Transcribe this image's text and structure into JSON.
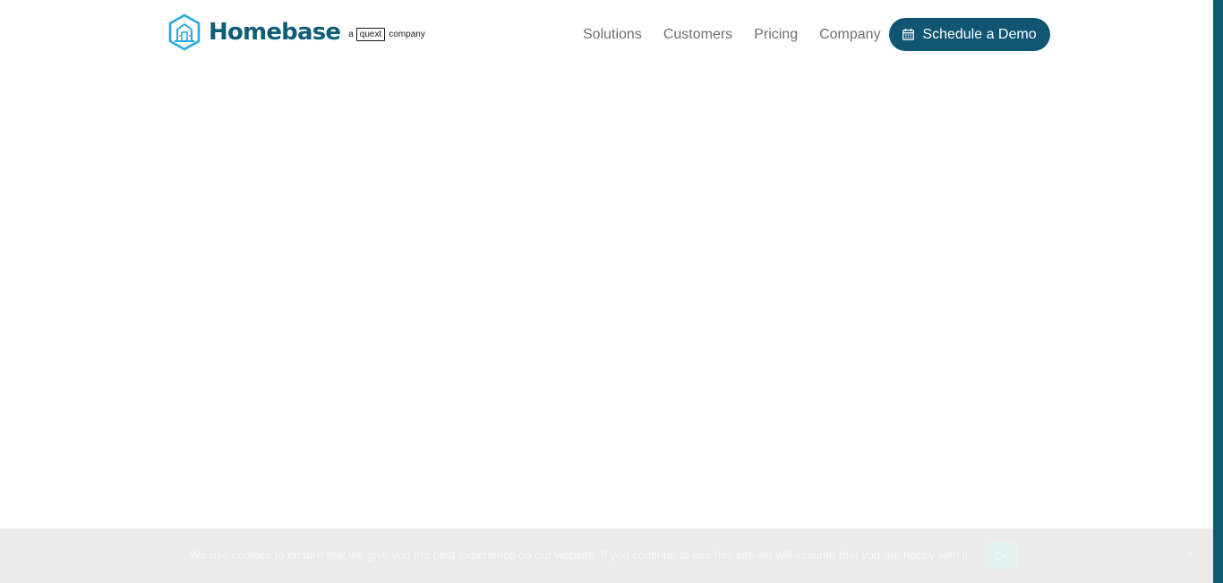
{
  "header": {
    "logo": {
      "wordmark": "Homebase",
      "tagline_prefix": "a",
      "tagline_brand": "quext",
      "tagline_suffix": "company",
      "icon": "homebase-hexagon-building-icon"
    },
    "nav": [
      {
        "label": "Solutions"
      },
      {
        "label": "Customers"
      },
      {
        "label": "Pricing"
      },
      {
        "label": "Company"
      }
    ],
    "cta": {
      "label": "Schedule a Demo",
      "icon": "calendar-icon"
    }
  },
  "cookie_notice": {
    "message": "We use cookies to ensure that we give you the best experience on our website. If you continue to use this site we will assume that you are happy with it.",
    "ok_label": "Ok",
    "close_icon": "close-icon"
  },
  "colors": {
    "brand_dark": "#0f5673",
    "brand_light": "#29a9df",
    "nav_text": "#707070",
    "cookie_bar": "#ebebeb"
  }
}
